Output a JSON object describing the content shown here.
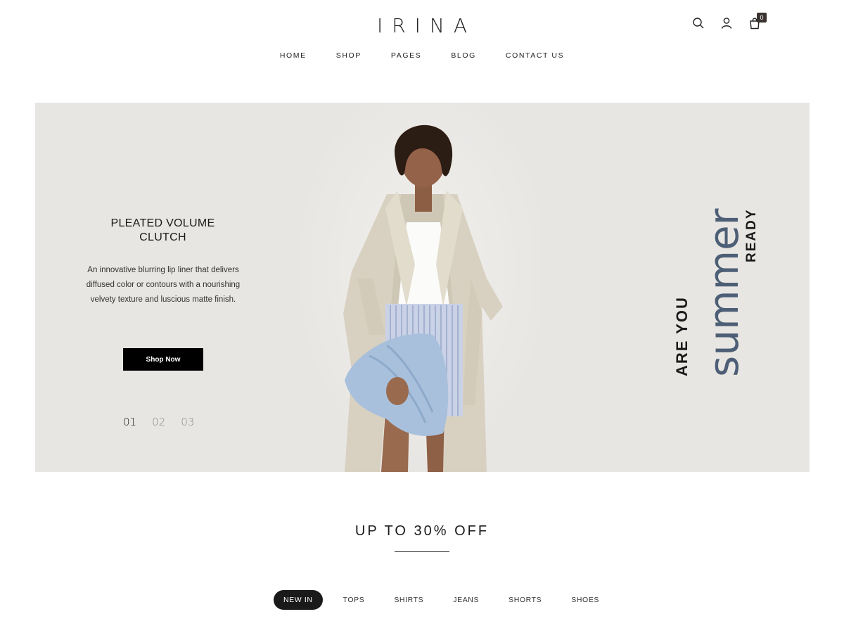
{
  "header": {
    "logo": "IRINA",
    "cart_count": "0",
    "icons": [
      "search-icon",
      "user-icon",
      "cart-icon"
    ]
  },
  "nav": {
    "items": [
      {
        "label": "HOME"
      },
      {
        "label": "SHOP"
      },
      {
        "label": "PAGES"
      },
      {
        "label": "BLOG"
      },
      {
        "label": "CONTACT US"
      }
    ]
  },
  "hero": {
    "title_line1": "PLEATED VOLUME",
    "title_line2": "CLUTCH",
    "desc_line1": "An innovative blurring lip liner that delivers",
    "desc_line2": "diffused color or contours with a nourishing",
    "desc_line3": "velvety texture and luscious matte finish.",
    "button_label": "Shop Now",
    "slides": [
      "01",
      "02",
      "03"
    ],
    "active_slide": "01",
    "tagline_a": "ARE YOU",
    "tagline_b": "summer",
    "tagline_c": "READY",
    "colors": {
      "background": "#e8e6e3",
      "accent": "#4d5f76"
    }
  },
  "section": {
    "title": "UP TO 30% OFF",
    "filters": [
      {
        "label": "NEW IN"
      },
      {
        "label": "TOPS"
      },
      {
        "label": "SHIRTS"
      },
      {
        "label": "JEANS"
      },
      {
        "label": "SHORTS"
      },
      {
        "label": "SHOES"
      }
    ],
    "active_filter": "NEW IN"
  }
}
